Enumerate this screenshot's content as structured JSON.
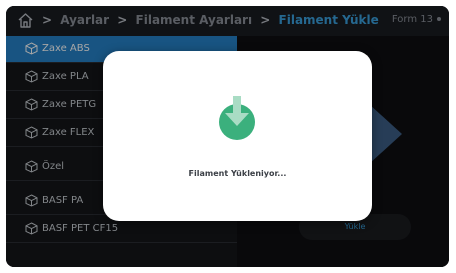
{
  "header": {
    "breadcrumb": [
      "Ayarlar",
      "Filament Ayarları",
      "Filament Yükle"
    ],
    "separator": ">",
    "machine_name": "Form 13"
  },
  "filament_list": {
    "items": [
      {
        "label": "Zaxe ABS",
        "selected": true
      },
      {
        "label": "Zaxe PLA",
        "selected": false
      },
      {
        "label": "Zaxe PETG",
        "selected": false
      },
      {
        "label": "Zaxe FLEX",
        "selected": false
      },
      {
        "label": "Özel",
        "selected": false
      },
      {
        "label": "BASF PA",
        "selected": false
      },
      {
        "label": "BASF PET CF15",
        "selected": false
      }
    ]
  },
  "panel": {
    "load_button_label": "Yükle"
  },
  "modal": {
    "message": "Filament Yükleniyor..."
  },
  "colors": {
    "accent": "#2682c8",
    "breadcrumb_current": "#3aa0dd",
    "spinner": "#3bb07d"
  },
  "icons": {
    "home": "home-icon",
    "filament": "cube-icon",
    "loading": "download-arrow-icon"
  }
}
